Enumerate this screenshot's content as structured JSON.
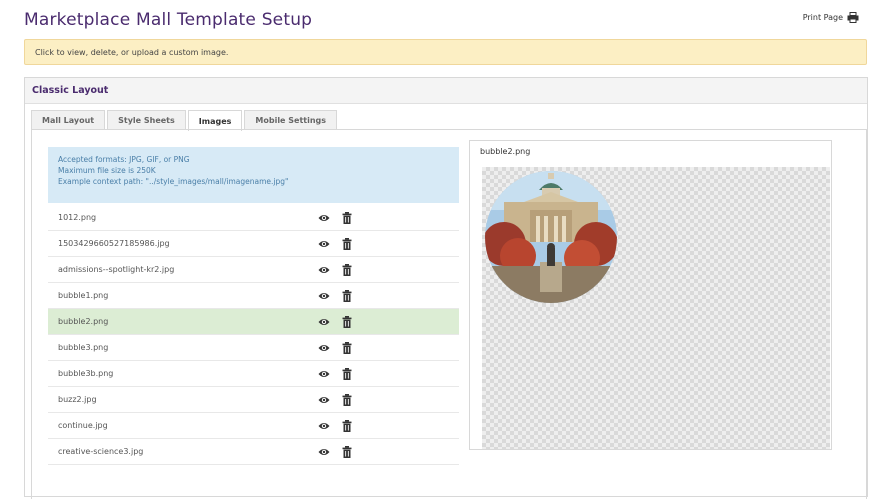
{
  "header": {
    "title": "Marketplace Mall Template Setup",
    "print_label": "Print Page",
    "print_icon": "printer-icon"
  },
  "info_banner": {
    "text": "Click to view, delete, or upload a custom image."
  },
  "panel": {
    "title": "Classic Layout"
  },
  "tabs": [
    {
      "label": "Mall Layout",
      "active": false
    },
    {
      "label": "Style Sheets",
      "active": false
    },
    {
      "label": "Images",
      "active": true
    },
    {
      "label": "Mobile Settings",
      "active": false
    }
  ],
  "formats_box": {
    "line1": "Accepted formats: JPG, GIF, or PNG",
    "line2": "Maximum file size is 250K",
    "line3": "Example context path: \"../style_images/mall/imagename.jpg\""
  },
  "files": [
    {
      "name": "1012.png"
    },
    {
      "name": "1503429660527185986.jpg"
    },
    {
      "name": "admissions--spotlight-kr2.jpg"
    },
    {
      "name": "bubble1.png"
    },
    {
      "name": "bubble2.png",
      "selected": true
    },
    {
      "name": "bubble3.png"
    },
    {
      "name": "bubble3b.png"
    },
    {
      "name": "buzz2.jpg"
    },
    {
      "name": "continue.jpg"
    },
    {
      "name": "creative-science3.jpg"
    }
  ],
  "row_icons": {
    "view": "eye-icon",
    "delete": "trash-icon"
  },
  "preview": {
    "title": "bubble2.png"
  },
  "colors": {
    "title_purple": "#4a2b6e",
    "banner_bg": "#fcefc4",
    "info_bg": "#d7eaf6",
    "selected_row": "#dcedd4"
  }
}
